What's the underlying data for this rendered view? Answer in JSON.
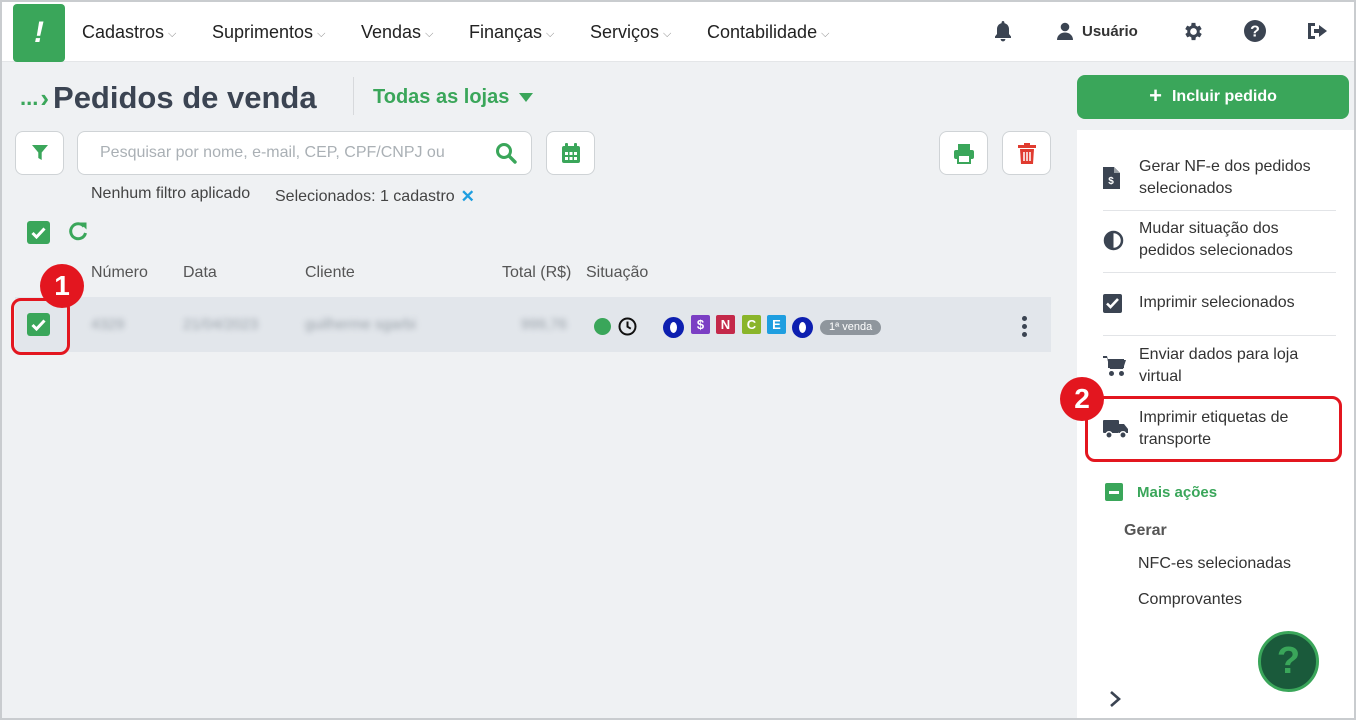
{
  "nav": {
    "logo": "!",
    "items": [
      {
        "label": "Cadastros"
      },
      {
        "label": "Suprimentos"
      },
      {
        "label": "Vendas"
      },
      {
        "label": "Finanças"
      },
      {
        "label": "Serviços"
      },
      {
        "label": "Contabilidade"
      }
    ],
    "user_label": "Usuário"
  },
  "page": {
    "breadcrumb_dots": "...",
    "title": "Pedidos de venda",
    "store_select": "Todas as lojas"
  },
  "toolbar": {
    "search_placeholder": "Pesquisar por nome, e-mail, CEP, CPF/CNPJ ou",
    "filter_status": "Nenhum filtro aplicado",
    "selected_status": "Selecionados: 1 cadastro",
    "clear_selection": "✕"
  },
  "table": {
    "columns": [
      "Número",
      "Data",
      "Cliente",
      "Total (R$)",
      "Situação"
    ],
    "rows": [
      {
        "numero": "4329",
        "data": "21/04/2023",
        "cliente": "guilherme sgarbi",
        "total": "999,76",
        "badges": [
          "$",
          "N",
          "C",
          "E"
        ],
        "tag": "1ª venda",
        "selected": true
      }
    ]
  },
  "sidebar": {
    "add_button": "Incluir pedido",
    "actions": [
      {
        "label": "Gerar NF-e dos pedidos selecionados",
        "icon": "invoice-icon"
      },
      {
        "label": "Mudar situação dos pedidos selecionados",
        "icon": "half-circle-icon"
      },
      {
        "label": "Imprimir selecionados",
        "icon": "checkbox-icon"
      },
      {
        "label": "Enviar dados para loja virtual",
        "icon": "cart-icon"
      },
      {
        "label": "Imprimir etiquetas de transporte",
        "icon": "truck-icon"
      }
    ],
    "more_label": "Mais ações",
    "generate_heading": "Gerar",
    "generate_items": [
      "NFC-es selecionadas",
      "Comprovantes"
    ],
    "help_label": "?"
  },
  "annotations": [
    {
      "number": "1"
    },
    {
      "number": "2"
    }
  ],
  "colors": {
    "brand_green": "#3aa65a",
    "annotation_red": "#e3161f",
    "danger": "#e03b2f",
    "badge_o": "#0d1fb0",
    "badge_s": "#7b3fc4",
    "badge_n": "#c4294a",
    "badge_c": "#8ab52a",
    "badge_e": "#1e9ee0"
  }
}
